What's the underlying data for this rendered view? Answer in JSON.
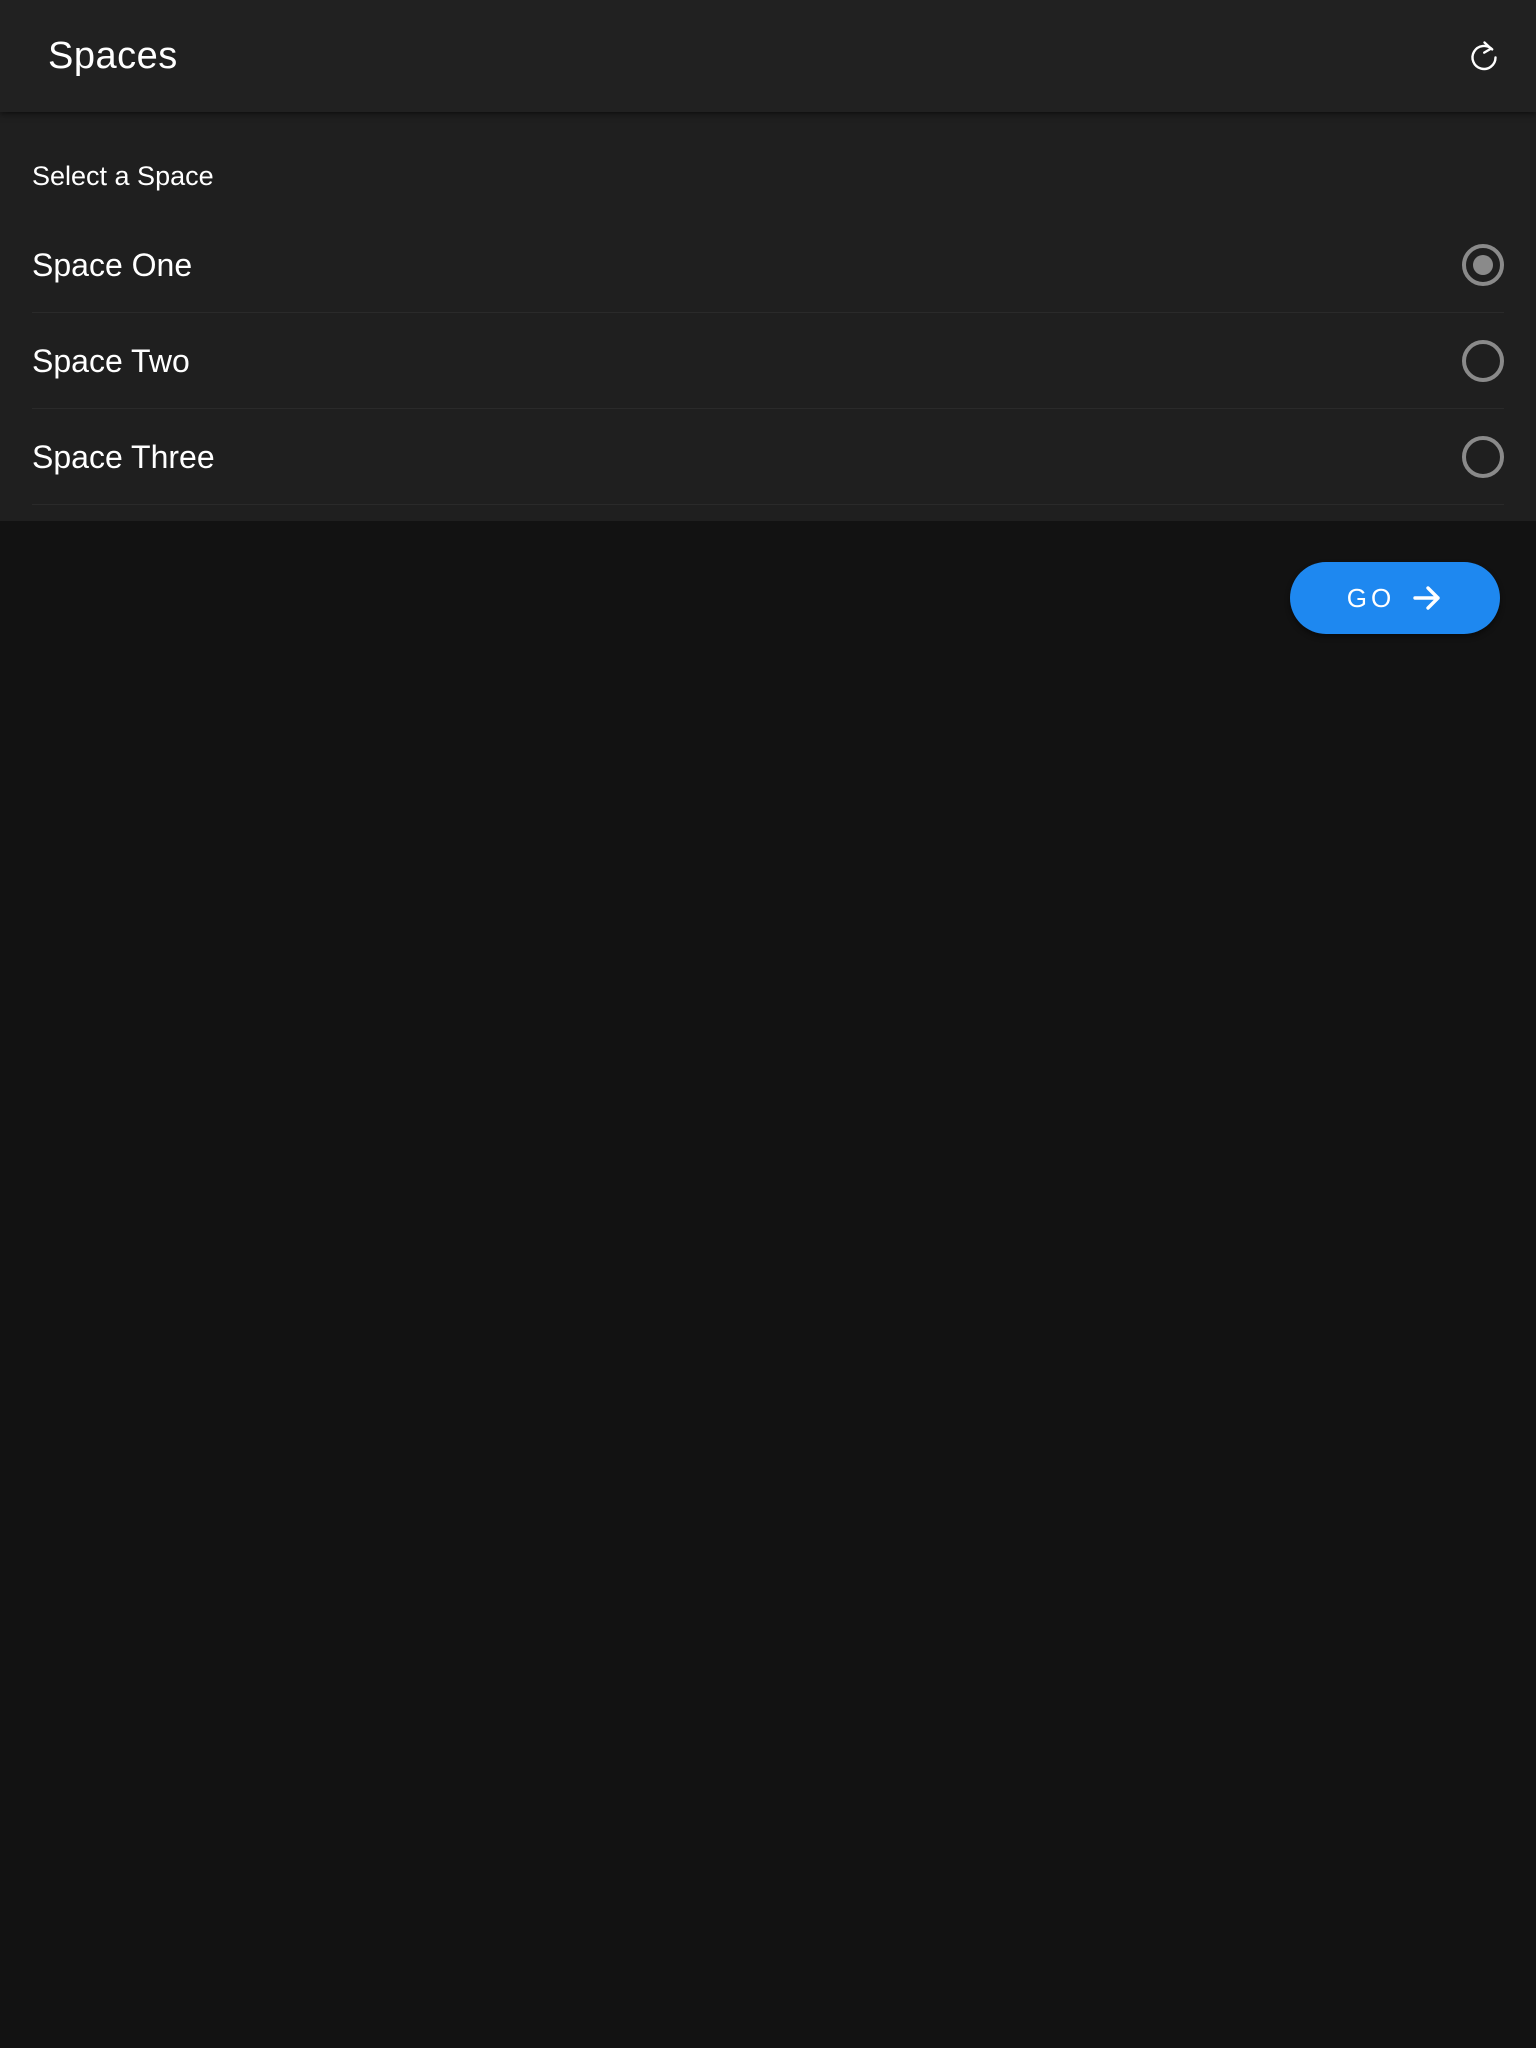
{
  "app_bar": {
    "title": "Spaces",
    "refresh_icon": "refresh-icon"
  },
  "selector": {
    "label": "Select a Space",
    "items": [
      {
        "label": "Space One",
        "selected": true
      },
      {
        "label": "Space Two",
        "selected": false
      },
      {
        "label": "Space Three",
        "selected": false
      }
    ]
  },
  "go_button": {
    "label": "GO",
    "icon": "arrow-right-icon"
  },
  "colors": {
    "background": "#121212",
    "app_bar": "#212121",
    "panel": "#1f1f1f",
    "accent": "#1e88f0",
    "radio": "#8a8a8a"
  }
}
